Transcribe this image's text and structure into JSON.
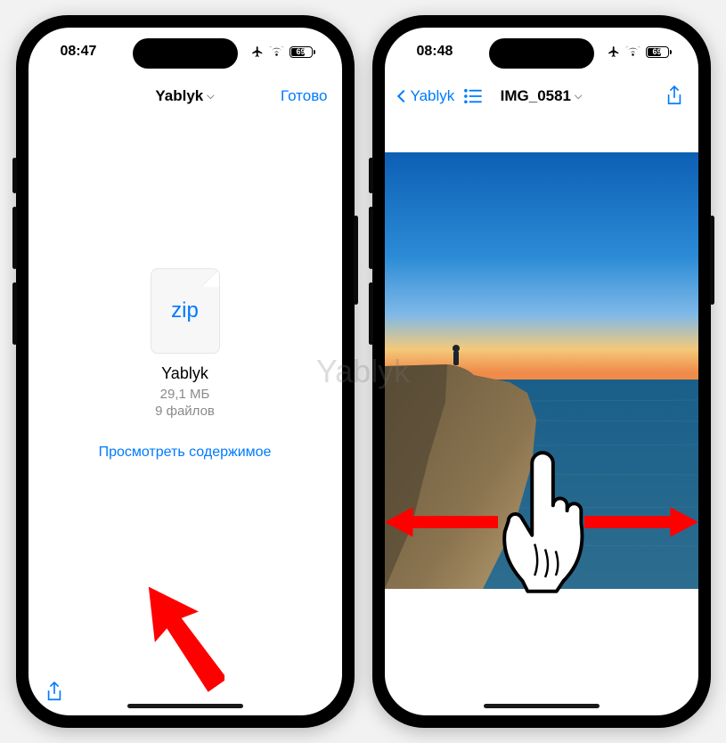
{
  "watermark": "Yablyk",
  "left": {
    "status": {
      "time": "08:47",
      "battery": "69"
    },
    "nav": {
      "title": "Yablyk",
      "done": "Готово"
    },
    "zip": {
      "ext": "zip",
      "name": "Yablyk",
      "size": "29,1 МБ",
      "count": "9 файлов",
      "view": "Просмотреть содержимое"
    }
  },
  "right": {
    "status": {
      "time": "08:48",
      "battery": "69"
    },
    "nav": {
      "back": "Yablyk",
      "title": "IMG_0581"
    }
  }
}
